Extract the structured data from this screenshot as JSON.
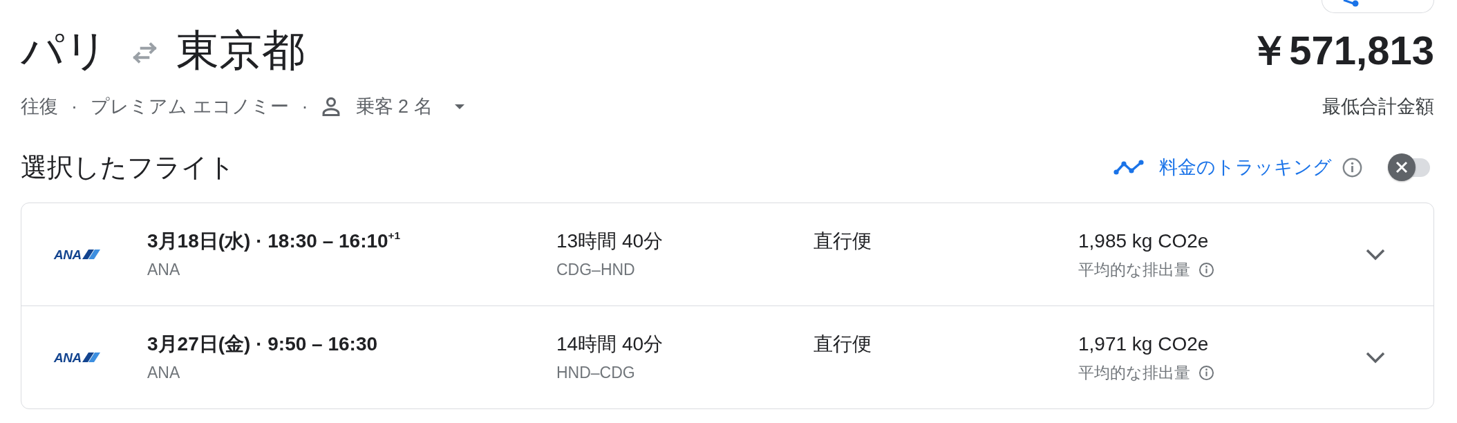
{
  "trip": {
    "origin": "パリ",
    "destination": "東京都",
    "details": [
      {
        "kind": "text",
        "text": "往復"
      },
      {
        "kind": "separator",
        "text": "·"
      },
      {
        "kind": "text",
        "text": "プレミアム エコノミー"
      },
      {
        "kind": "separator",
        "text": "·"
      },
      {
        "kind": "passengers",
        "text": "乗客 2 名"
      }
    ]
  },
  "price": {
    "amount": "￥571,813",
    "label": "最低合計金額"
  },
  "selected_flights": {
    "title": "選択したフライト",
    "price_tracking": {
      "label": "料金のトラッキング",
      "on": false
    },
    "flights": [
      {
        "airline_logo": "ANA",
        "schedule": "3月18日(水) · 18:30 – 16:10$^{+1}$",
        "airline": "ANA",
        "duration": "13時間 40分",
        "route": "CDG–HND",
        "stops": "直行便",
        "emissions": "1,985 kg CO2e",
        "emissions_label": "平均的な排出量",
        "expanded": false
      },
      {
        "airline_logo": "ANA",
        "schedule": "3月27日(金) · 9:50 – 16:30",
        "airline": "ANA",
        "duration": "14時間 40分",
        "route": "HND–CDG",
        "stops": "直行便",
        "emissions": "1,971 kg CO2e",
        "emissions_label": "平均的な排出量",
        "expanded": false
      }
    ]
  }
}
